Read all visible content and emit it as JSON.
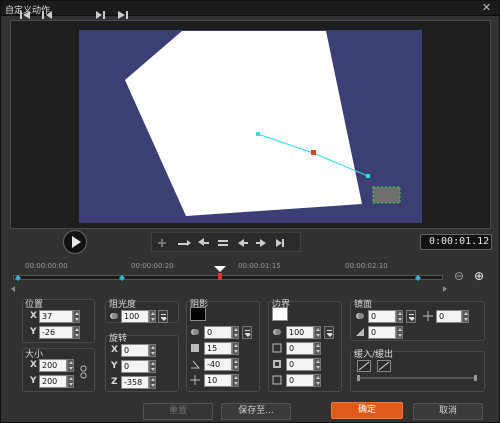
{
  "window": {
    "title": "自定义动作",
    "close_glyph": "✕"
  },
  "transport": {
    "timecode": "0:00:01.12"
  },
  "ruler": {
    "labels": [
      "00:00:00:00",
      "00:00:00:20",
      "00:00:01:15",
      "00:00:02:10"
    ]
  },
  "zoom": {
    "out_glyph": "⊖",
    "in_glyph": "⊕"
  },
  "position": {
    "title": "位置",
    "x_label": "X",
    "x_value": "37",
    "y_label": "Y",
    "y_value": "-26"
  },
  "size": {
    "title": "大小",
    "x_label": "X",
    "x_value": "200",
    "y_label": "Y",
    "y_value": "200"
  },
  "opacity": {
    "title": "阻光度",
    "value": "100"
  },
  "rotation": {
    "title": "旋转",
    "x_label": "X",
    "x_value": "0",
    "y_label": "Y",
    "y_value": "0",
    "z_label": "Z",
    "z_value": "-358"
  },
  "shadow": {
    "title": "阴影",
    "color": "#000000",
    "opacity_value": "0",
    "blur_value": "15",
    "angle_value": "-40",
    "distance_value": "10"
  },
  "border": {
    "title": "边界",
    "color": "#ffffff",
    "opacity_value": "100",
    "v1": "0",
    "v2": "0",
    "v3": "0"
  },
  "mirror": {
    "title": "镜面",
    "v1": "0",
    "v2": "0",
    "v3": "0"
  },
  "ease": {
    "title": "缓入/缓出"
  },
  "buttons": {
    "reset": "重置",
    "save_to": "保存至...",
    "ok": "确定",
    "cancel": "取消"
  },
  "colors": {
    "accent": "#e05a1a",
    "path": "#2ee0e0",
    "canvas": "#3b3f73"
  }
}
